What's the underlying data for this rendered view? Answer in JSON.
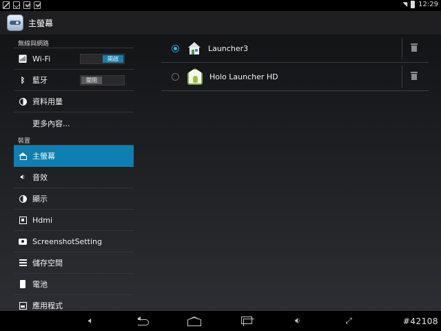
{
  "status_bar": {
    "time": "12:29"
  },
  "action_bar": {
    "title": "主螢幕"
  },
  "sidebar": {
    "section_wireless": "無線與網路",
    "section_device": "裝置",
    "items": [
      {
        "label": "Wi-Fi",
        "icon": "wifi-icon",
        "toggle": "開啟",
        "toggle_on": true
      },
      {
        "label": "藍牙",
        "icon": "bluetooth-icon",
        "toggle": "關閉",
        "toggle_on": false
      },
      {
        "label": "資料用量",
        "icon": "data-usage-icon"
      },
      {
        "label": "更多內容..."
      },
      {
        "label": "主螢幕",
        "icon": "home-icon",
        "selected": true
      },
      {
        "label": "音效",
        "icon": "sound-icon"
      },
      {
        "label": "顯示",
        "icon": "display-icon"
      },
      {
        "label": "Hdmi",
        "icon": "hdmi-icon"
      },
      {
        "label": "ScreenshotSetting",
        "icon": "screenshot-icon"
      },
      {
        "label": "儲存空間",
        "icon": "storage-icon"
      },
      {
        "label": "電池",
        "icon": "battery-icon"
      },
      {
        "label": "應用程式",
        "icon": "apps-icon"
      }
    ]
  },
  "launchers": [
    {
      "name": "Launcher3",
      "selected": true,
      "icon": "launcher3-icon"
    },
    {
      "name": "Holo Launcher HD",
      "selected": false,
      "icon": "holo-launcher-icon"
    }
  ],
  "nav_bar": {
    "watermark": "#42108"
  },
  "colors": {
    "accent": "#33b5e5",
    "selected_bg": "#0d7fb2"
  }
}
